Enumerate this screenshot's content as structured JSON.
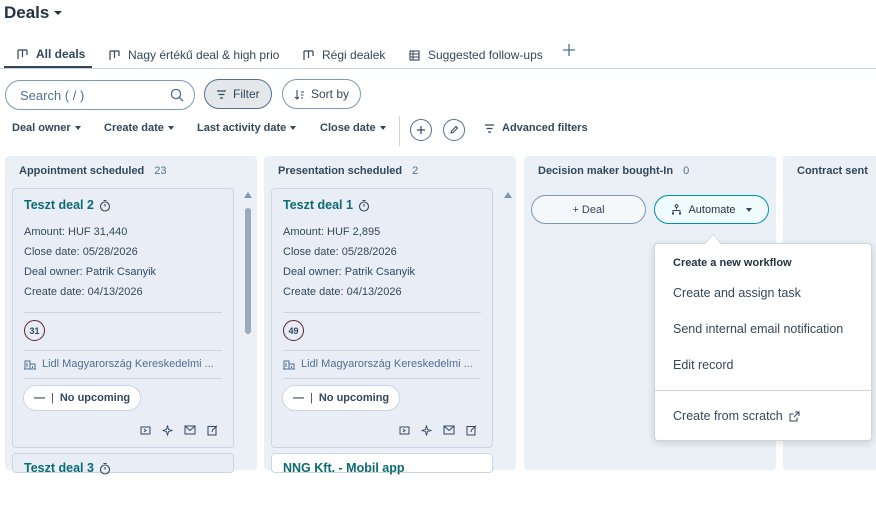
{
  "header": {
    "title": "Deals"
  },
  "tabs": [
    {
      "label": "All deals"
    },
    {
      "label": "Nagy értékű deal & high prio"
    },
    {
      "label": "Régi dealek"
    },
    {
      "label": "Suggested follow-ups"
    }
  ],
  "toolbar": {
    "search_placeholder": "Search ( / )",
    "filter_label": "Filter",
    "sort_label": "Sort by"
  },
  "filters": {
    "deal_owner": "Deal owner",
    "create_date": "Create date",
    "last_activity_date": "Last activity date",
    "close_date": "Close date",
    "advanced": "Advanced filters"
  },
  "columns": [
    {
      "name": "Appointment scheduled",
      "count": "23",
      "cards": [
        {
          "title": "Teszt deal 2",
          "amount": "Amount: HUF 31,440",
          "close_date": "Close date: 05/28/2026",
          "owner": "Deal owner: Patrik Csanyik",
          "create_date": "Create date: 04/13/2026",
          "badge": "31",
          "company": "Lidl Magyarország Kereskedelmi ...",
          "upcoming": "No upcoming"
        },
        {
          "title": "Teszt deal 3"
        }
      ]
    },
    {
      "name": "Presentation scheduled",
      "count": "2",
      "cards": [
        {
          "title": "Teszt deal 1",
          "amount": "Amount: HUF 2,895",
          "close_date": "Close date: 05/28/2026",
          "owner": "Deal owner: Patrik Csanyik",
          "create_date": "Create date: 04/13/2026",
          "badge": "49",
          "company": "Lidl Magyarország Kereskedelmi ...",
          "upcoming": "No upcoming"
        },
        {
          "title": "NNG Kft. - Mobil app"
        }
      ]
    },
    {
      "name": "Decision maker bought-In",
      "count": "0",
      "add_deal_label": "+ Deal",
      "automate_label": "Automate"
    },
    {
      "name": "Contract sent"
    }
  ],
  "automate_menu": {
    "heading": "Create a new workflow",
    "items": [
      "Create and assign task",
      "Send internal email notification",
      "Edit record"
    ],
    "footer_item": "Create from scratch"
  },
  "colors": {
    "accent_teal": "#0b6a72",
    "border": "#cbd6e2",
    "automate_blue": "#0091ae"
  }
}
